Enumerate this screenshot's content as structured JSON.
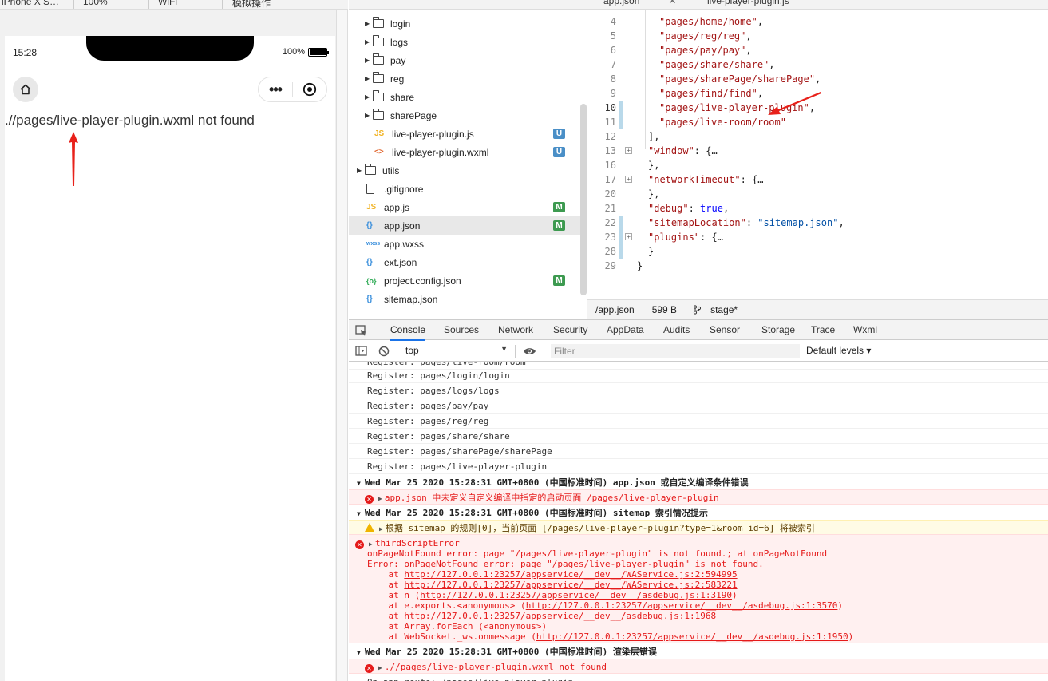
{
  "toolbar": {
    "device": "iPhone X S…",
    "zoom": "100%",
    "network": "WiFi",
    "mode": "模拟操作"
  },
  "phone": {
    "time": "15:28",
    "battery": "100%",
    "battery_level": 1.0,
    "message": ".//pages/live-player-plugin.wxml not found"
  },
  "tree": {
    "items": [
      {
        "type": "folder",
        "name": "login",
        "expanded": false
      },
      {
        "type": "folder",
        "name": "logs",
        "expanded": false
      },
      {
        "type": "folder",
        "name": "pay",
        "expanded": false
      },
      {
        "type": "folder",
        "name": "reg",
        "expanded": false
      },
      {
        "type": "folder",
        "name": "share",
        "expanded": false
      },
      {
        "type": "folder",
        "name": "sharePage",
        "expanded": false
      },
      {
        "type": "js",
        "icon": "JS",
        "name": "live-player-plugin.js",
        "badge": "U"
      },
      {
        "type": "wxml",
        "icon": "<>",
        "name": "live-player-plugin.wxml",
        "badge": "U"
      },
      {
        "type": "folder",
        "name": "utils",
        "expanded": false
      },
      {
        "type": "doc",
        "name": ".gitignore",
        "badge": ""
      },
      {
        "type": "js",
        "icon": "JS",
        "name": "app.js",
        "badge": "M"
      },
      {
        "type": "json",
        "icon": "{}",
        "name": "app.json",
        "badge": "M",
        "selected": true
      },
      {
        "type": "wxss",
        "icon": "wxss",
        "name": "app.wxss",
        "badge": ""
      },
      {
        "type": "json",
        "icon": "{}",
        "name": "ext.json",
        "badge": ""
      },
      {
        "type": "cfg",
        "icon": "{o}",
        "name": "project.config.json",
        "badge": "M"
      },
      {
        "type": "json",
        "icon": "{}",
        "name": "sitemap.json",
        "badge": ""
      }
    ]
  },
  "editor": {
    "tabs": [
      "app.json",
      "live-player-plugin.js"
    ],
    "lines": [
      {
        "n": "4",
        "text": "\"pages/home/home\",",
        "indent": 2
      },
      {
        "n": "5",
        "text": "\"pages/reg/reg\",",
        "indent": 2
      },
      {
        "n": "6",
        "text": "\"pages/pay/pay\",",
        "indent": 2
      },
      {
        "n": "7",
        "text": "\"pages/share/share\",",
        "indent": 2
      },
      {
        "n": "8",
        "text": "\"pages/sharePage/sharePage\",",
        "indent": 2
      },
      {
        "n": "9",
        "text": "\"pages/find/find\",",
        "indent": 2
      },
      {
        "n": "10",
        "text": "\"pages/live-player-plugin\",",
        "indent": 2
      },
      {
        "n": "11",
        "text": "\"pages/live-room/room\"",
        "indent": 2
      },
      {
        "n": "12",
        "text": "],",
        "indent": 1
      },
      {
        "n": "13",
        "text": "\"window\": {…",
        "indent": 1
      },
      {
        "n": "16",
        "text": "},",
        "indent": 1
      },
      {
        "n": "17",
        "text": "\"networkTimeout\": {…",
        "indent": 1
      },
      {
        "n": "20",
        "text": "},",
        "indent": 1
      },
      {
        "n": "21",
        "text": "\"debug\": true,",
        "indent": 1
      },
      {
        "n": "22",
        "text": "\"sitemapLocation\": \"sitemap.json\",",
        "indent": 1
      },
      {
        "n": "23",
        "text": "\"plugins\": {…",
        "indent": 1
      },
      {
        "n": "28",
        "text": "}",
        "indent": 1
      },
      {
        "n": "29",
        "text": "}",
        "indent": 0
      }
    ]
  },
  "status": {
    "path": "/app.json",
    "size": "599 B",
    "branch": "stage*"
  },
  "devtools": {
    "tabs": [
      "Console",
      "Sources",
      "Network",
      "Security",
      "AppData",
      "Audits",
      "Sensor",
      "Storage",
      "Trace",
      "Wxml"
    ],
    "active_tab": "Console",
    "context": "top",
    "filter_placeholder": "Filter",
    "levels": "Default levels ▾"
  },
  "console": {
    "partial_top": "Register: pages/live-room/room",
    "registers": [
      "Register: pages/login/login",
      "Register: pages/logs/logs",
      "Register: pages/pay/pay",
      "Register: pages/reg/reg",
      "Register: pages/share/share",
      "Register: pages/sharePage/sharePage",
      "Register: pages/live-player-plugin"
    ],
    "group1": "Wed Mar 25 2020 15:28:31 GMT+0800 (中国标准时间) app.json 或自定义编译条件错误",
    "err1": "app.json 中未定义自定义编译中指定的启动页面 /pages/live-player-plugin",
    "group2": "Wed Mar 25 2020 15:28:31 GMT+0800 (中国标准时间) sitemap 索引情况提示",
    "warn1": "根据 sitemap 的规则[0]，当前页面 [/pages/live-player-plugin?type=1&room_id=6] 将被索引",
    "third_title": "thirdScriptError",
    "third_lines": [
      "onPageNotFound error: page \"/pages/live-player-plugin\" is not found.; at onPageNotFound",
      "Error: onPageNotFound error: page \"/pages/live-player-plugin\" is not found.",
      "    at http://127.0.0.1:23257/appservice/__dev__/WAService.js:2:594995",
      "    at http://127.0.0.1:23257/appservice/__dev__/WAService.js:2:583221",
      "    at n (http://127.0.0.1:23257/appservice/__dev__/asdebug.js:1:3190)",
      "    at e.exports.<anonymous> (http://127.0.0.1:23257/appservice/__dev__/asdebug.js:1:3570)",
      "    at http://127.0.0.1:23257/appservice/__dev__/asdebug.js:1:1968",
      "    at Array.forEach (<anonymous>)",
      "    at WebSocket._ws.onmessage (http://127.0.0.1:23257/appservice/__dev__/asdebug.js:1:1950)"
    ],
    "group3": "Wed Mar 25 2020 15:28:31 GMT+0800 (中国标准时间) 渲染层错误",
    "err3": ".//pages/live-player-plugin.wxml not found",
    "partial_bottom": "On app route: /pages/live-player-plugin"
  },
  "colors": {
    "error": "#e51a1a",
    "warning_bg": "#fffbe5",
    "error_bg": "#fff0f0",
    "arrow": "#e8211a",
    "accent": "#1a73e8"
  }
}
